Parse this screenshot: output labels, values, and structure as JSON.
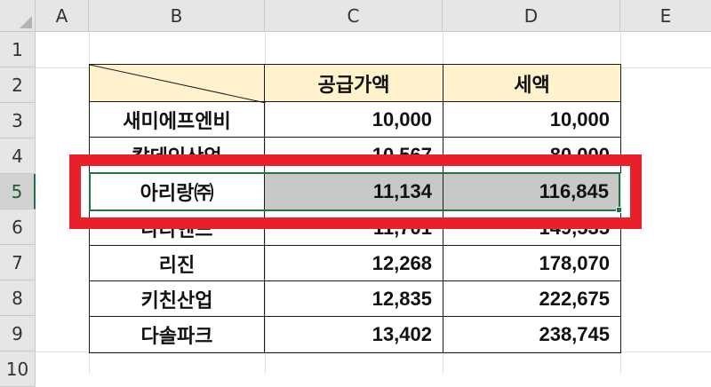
{
  "columns": [
    "A",
    "B",
    "C",
    "D",
    "E"
  ],
  "rows": [
    "1",
    "2",
    "3",
    "4",
    "5",
    "6",
    "7",
    "8",
    "9",
    "10"
  ],
  "selected_row": "5",
  "table": {
    "headers": [
      "공급가액",
      "세액"
    ],
    "entries": [
      {
        "row": "3",
        "name": "새미에프엔비",
        "supply": "10,000",
        "tax": "10,000"
      },
      {
        "row": "4",
        "name": "칼데인산업",
        "supply": "10,567",
        "tax": "80,000"
      },
      {
        "row": "5",
        "name": "아리랑㈜",
        "supply": "11,134",
        "tax": "116,845"
      },
      {
        "row": "6",
        "name": "나라엔드",
        "supply": "11,701",
        "tax": "149,535"
      },
      {
        "row": "7",
        "name": "리진",
        "supply": "12,268",
        "tax": "178,070"
      },
      {
        "row": "8",
        "name": "키친산업",
        "supply": "12,835",
        "tax": "222,675"
      },
      {
        "row": "9",
        "name": "다솔파크",
        "supply": "13,402",
        "tax": "238,745"
      }
    ]
  },
  "colors": {
    "header_fill": "#fff2cc",
    "highlight_fill": "#c8c8c8",
    "annotation_red": "#e8202a",
    "selection_green": "#217346"
  }
}
